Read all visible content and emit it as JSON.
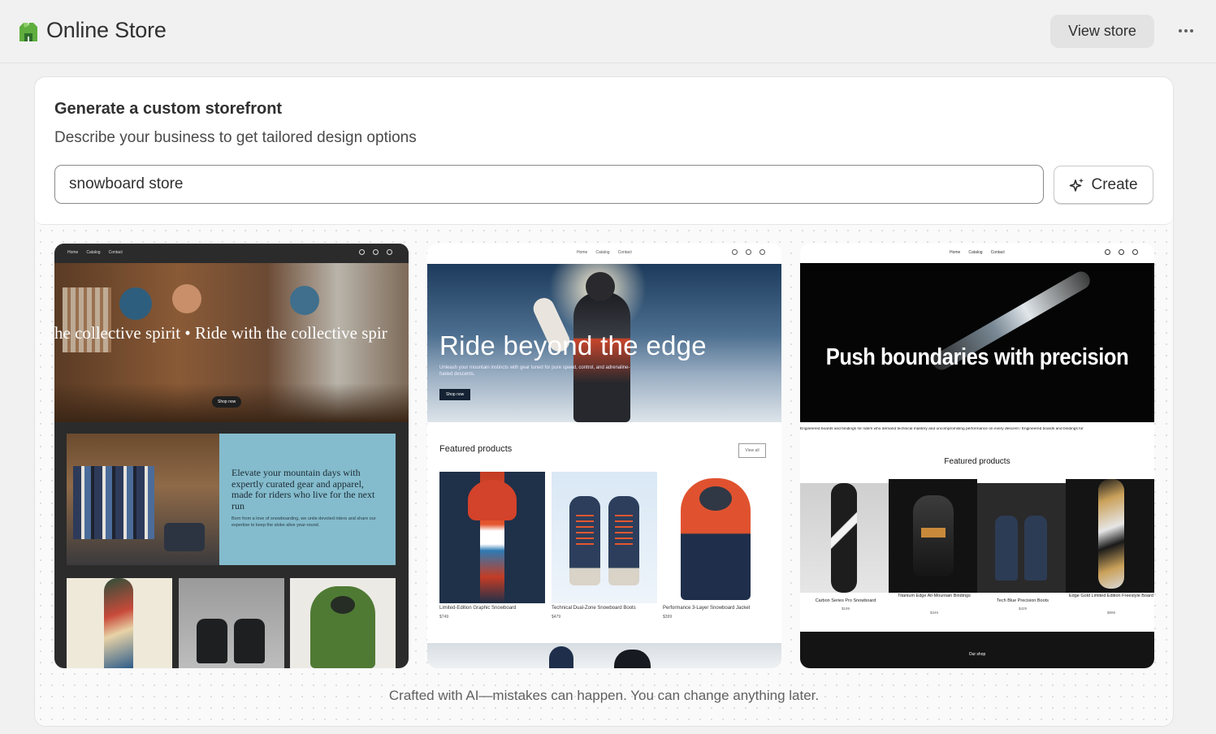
{
  "app": {
    "title": "Online Store",
    "logo_icon": "shopify-bag-icon"
  },
  "header": {
    "view_store_label": "View store",
    "more_icon": "more-horizontal-icon"
  },
  "generator": {
    "title": "Generate a custom storefront",
    "subtitle": "Describe your business to get tailored design options",
    "prompt_value": "snowboard store",
    "create_label": "Create",
    "create_icon": "sparkle-icon"
  },
  "previews": [
    {
      "nav": [
        "Home",
        "Catalog",
        "Contact"
      ],
      "hero_marquee": "he collective spirit  •  Ride with the collective spir",
      "hero_button": "Shop now",
      "feature_heading": "Elevate your mountain days with expertly curated gear and apparel, made for riders who live for the next run",
      "feature_body": "Born from a love of snowboarding, we unite devoted riders and share our expertise to keep the stoke alive year-round."
    },
    {
      "nav": [
        "Home",
        "Catalog",
        "Contact"
      ],
      "hero_title": "Ride beyond the edge",
      "hero_body": "Unleash your mountain instincts with gear tuned for pure speed, control, and adrenaline-fueled descents.",
      "hero_button": "Shop now",
      "section_title": "Featured products",
      "view_all": "View all",
      "products": [
        {
          "name": "Limited-Edition Graphic Snowboard",
          "price": "$749"
        },
        {
          "name": "Technical Dual-Zone Snowboard Boots",
          "price": "$479"
        },
        {
          "name": "Performance 3-Layer Snowboard Jacket",
          "price": "$399"
        }
      ]
    },
    {
      "nav": [
        "Home",
        "Catalog",
        "Contact"
      ],
      "hero_title": "Push boundaries with precision",
      "marquee": "Engineered boards and bindings for riders who demand technical mastery and uncompromising performance on every descent    /    Engineered boards and bindings for",
      "section_title": "Featured products",
      "products": [
        {
          "name": "Carbon Series Pro Snowboard",
          "price": "$199"
        },
        {
          "name": "Titanium Edge All-Mountain Bindings",
          "price": "$349"
        },
        {
          "name": "Tech Blue Precision Boots",
          "price": "$429"
        },
        {
          "name": "Edge Gold Limited Edition Freestyle Board",
          "price": "$899"
        }
      ],
      "footer_button": "Our shop"
    }
  ],
  "footnote": "Crafted with AI—mistakes can happen. You can change anything later."
}
